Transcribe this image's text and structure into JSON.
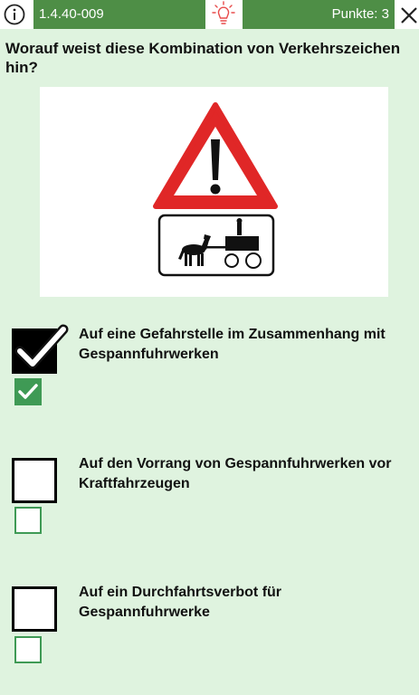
{
  "header": {
    "question_id": "1.4.40-009",
    "points_label": "Punkte: 3",
    "icons": [
      "info-icon",
      "lightbulb-icon",
      "close-icon"
    ]
  },
  "question": {
    "text": "Worauf weist diese Kombination von Verkehrszeichen hin?"
  },
  "image": {
    "sign": "danger-warning-triangle",
    "supplementary_sign": "horse-drawn-carriage"
  },
  "answers": [
    {
      "text": "Auf eine Gefahrstelle im Zusammenhang mit Gespannfuhrwerken",
      "checked": true,
      "solution_checked": true
    },
    {
      "text": "Auf den Vorrang von Gespannfuhrwerken vor Kraftfahrzeugen",
      "checked": false,
      "solution_checked": false
    },
    {
      "text": "Auf ein Durchfahrtsverbot für Gespannfuhrwerke",
      "checked": false,
      "solution_checked": false
    }
  ],
  "colors": {
    "background": "#dff3df",
    "header_green": "#4e8e46",
    "solution_green": "#3f9a55",
    "sign_red": "#e02727",
    "hint_red": "#e84b4b"
  }
}
